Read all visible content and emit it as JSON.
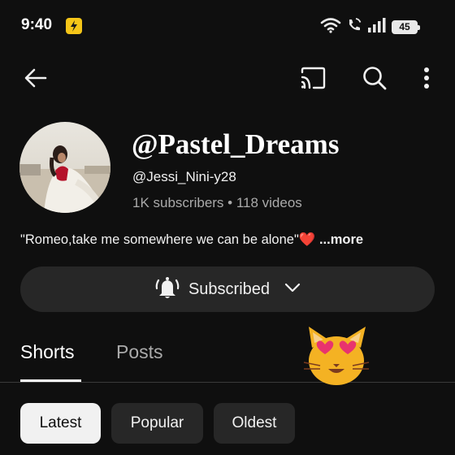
{
  "status_bar": {
    "time": "9:40",
    "battery": "45",
    "icons": [
      "flipkart-bolt-icon",
      "wifi-icon",
      "wifi-call-icon",
      "signal-icon",
      "battery-icon"
    ]
  },
  "top_bar": {
    "icons": [
      "back-arrow-icon",
      "cast-icon",
      "search-icon",
      "more-vert-icon"
    ]
  },
  "channel": {
    "name": "@Pastel_Dreams",
    "handle": "@Jessi_Nini-y28",
    "meta": "1K subscribers • 118 videos",
    "description": "\"Romeo,take me somewhere we can be alone\"",
    "description_emoji": "❤️",
    "more_label": " ...more"
  },
  "subscribe": {
    "label": "Subscribed",
    "icons": [
      "bell-ringing-icon",
      "chevron-down-icon"
    ]
  },
  "tabs": [
    {
      "label": "Shorts",
      "active": true
    },
    {
      "label": "Posts",
      "active": false
    }
  ],
  "chips": [
    {
      "label": "Latest",
      "selected": true
    },
    {
      "label": "Popular",
      "selected": false
    },
    {
      "label": "Oldest",
      "selected": false
    }
  ],
  "sticker": "heart-eyes-cat-emoji",
  "colors": {
    "background": "#0f0f0f",
    "pill": "#272727",
    "text": "#f1f1f1",
    "muted": "#aaaaaa",
    "heart": "#e0245e"
  }
}
